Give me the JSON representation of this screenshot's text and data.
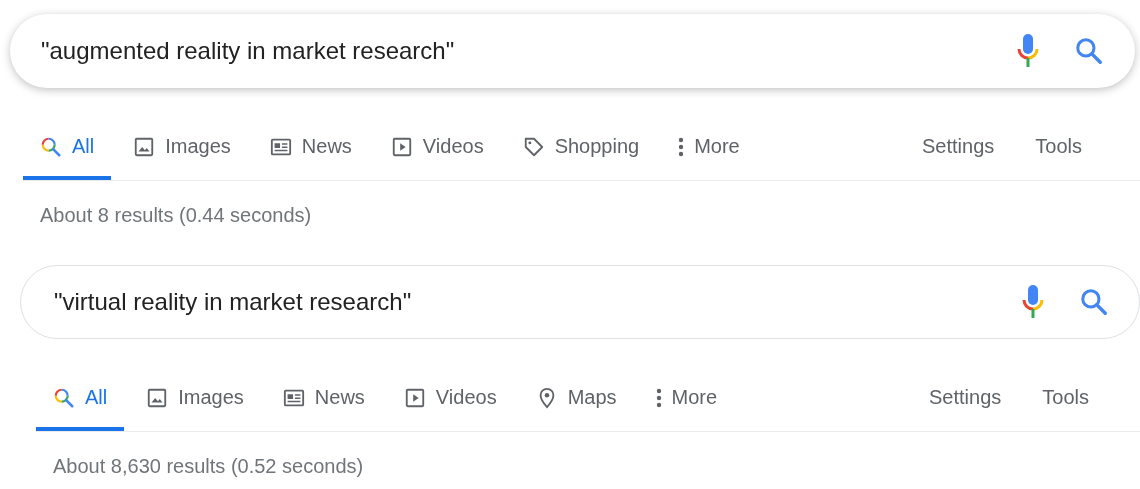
{
  "searches": [
    {
      "query": "\"augmented reality in market research\"",
      "focused": true,
      "tabs": [
        {
          "kind": "all",
          "label": "All",
          "selected": true
        },
        {
          "kind": "images",
          "label": "Images",
          "selected": false
        },
        {
          "kind": "news",
          "label": "News",
          "selected": false
        },
        {
          "kind": "videos",
          "label": "Videos",
          "selected": false
        },
        {
          "kind": "shopping",
          "label": "Shopping",
          "selected": false
        },
        {
          "kind": "more",
          "label": "More",
          "selected": false
        }
      ],
      "tools": [
        "Settings",
        "Tools"
      ],
      "stats": "About 8 results (0.44 seconds)"
    },
    {
      "query": "\"virtual reality in market research\"",
      "focused": false,
      "tabs": [
        {
          "kind": "all",
          "label": "All",
          "selected": true
        },
        {
          "kind": "images",
          "label": "Images",
          "selected": false
        },
        {
          "kind": "news",
          "label": "News",
          "selected": false
        },
        {
          "kind": "videos",
          "label": "Videos",
          "selected": false
        },
        {
          "kind": "maps",
          "label": "Maps",
          "selected": false
        },
        {
          "kind": "more",
          "label": "More",
          "selected": false
        }
      ],
      "tools": [
        "Settings",
        "Tools"
      ],
      "stats": "About 8,630 results (0.52 seconds)"
    }
  ]
}
